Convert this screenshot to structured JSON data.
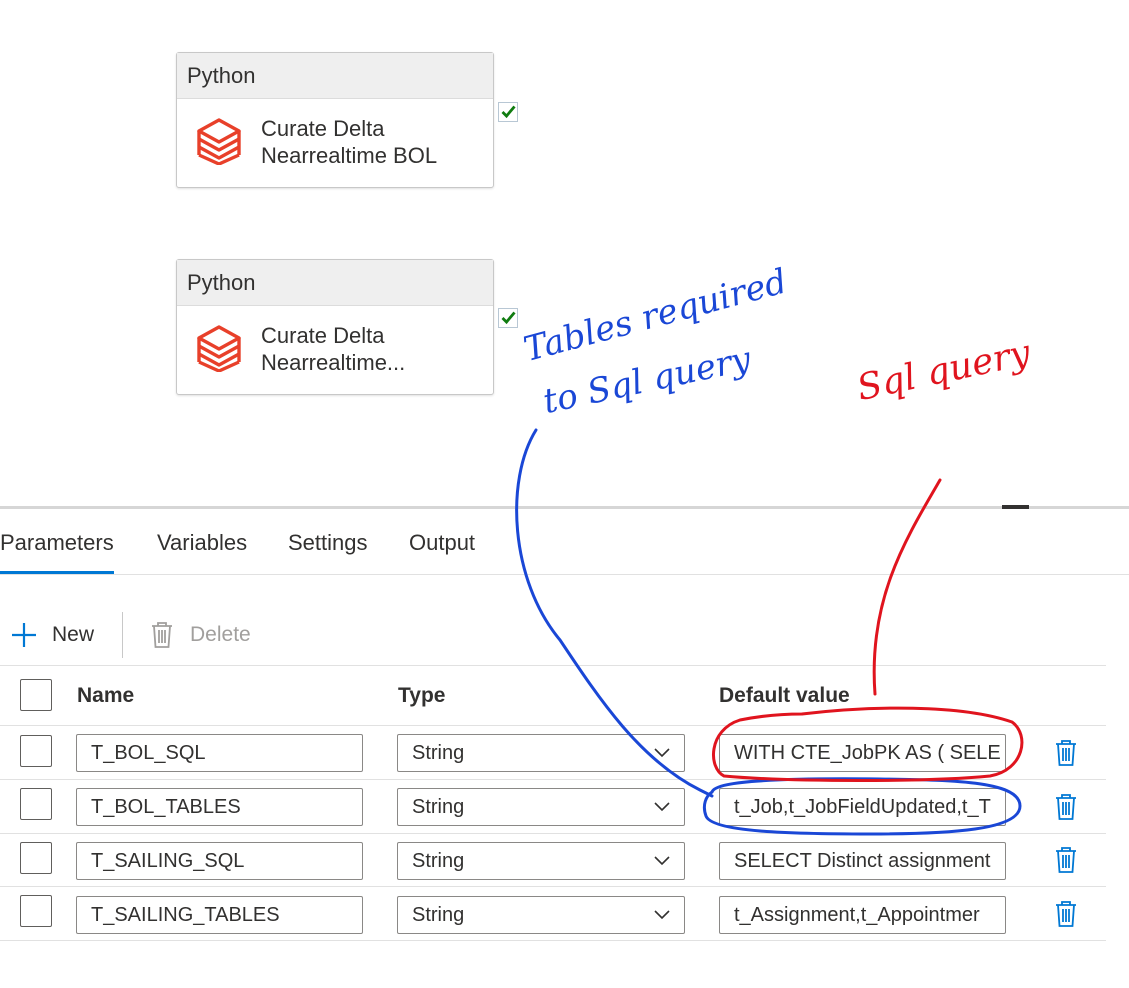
{
  "canvas": {
    "activities": [
      {
        "type_label": "Python",
        "name": "Curate Delta Nearrealtime BOL",
        "icon": "databricks-icon",
        "status_icon": "checkmark-icon"
      },
      {
        "type_label": "Python",
        "name": "Curate Delta Nearrealtime...",
        "icon": "databricks-icon",
        "status_icon": "checkmark-icon"
      }
    ]
  },
  "tabs": [
    {
      "label": "Parameters",
      "active": true
    },
    {
      "label": "Variables",
      "active": false
    },
    {
      "label": "Settings",
      "active": false
    },
    {
      "label": "Output",
      "active": false
    }
  ],
  "toolbar": {
    "new_label": "New",
    "delete_label": "Delete",
    "new_icon": "plus-icon",
    "delete_icon": "trash-icon"
  },
  "table": {
    "headers": {
      "name": "Name",
      "type": "Type",
      "default": "Default value"
    },
    "rows": [
      {
        "name": "T_BOL_SQL",
        "type": "String",
        "default": "WITH CTE_JobPK AS (  SELE"
      },
      {
        "name": "T_BOL_TABLES",
        "type": "String",
        "default": "t_Job,t_JobFieldUpdated,t_T"
      },
      {
        "name": "T_SAILING_SQL",
        "type": "String",
        "default": "SELECT Distinct  assignment"
      },
      {
        "name": "T_SAILING_TABLES",
        "type": "String",
        "default": "t_Assignment,t_Appointmer"
      }
    ]
  },
  "annotations": {
    "blue_text_line1": "Tables required",
    "blue_text_line2": "to Sql query",
    "red_text": "Sql query",
    "blue_color": "#1a47d6",
    "red_color": "#e0141e"
  },
  "colors": {
    "accent": "#0078d4",
    "databricks": "#e8402a",
    "check": "#107c10"
  }
}
